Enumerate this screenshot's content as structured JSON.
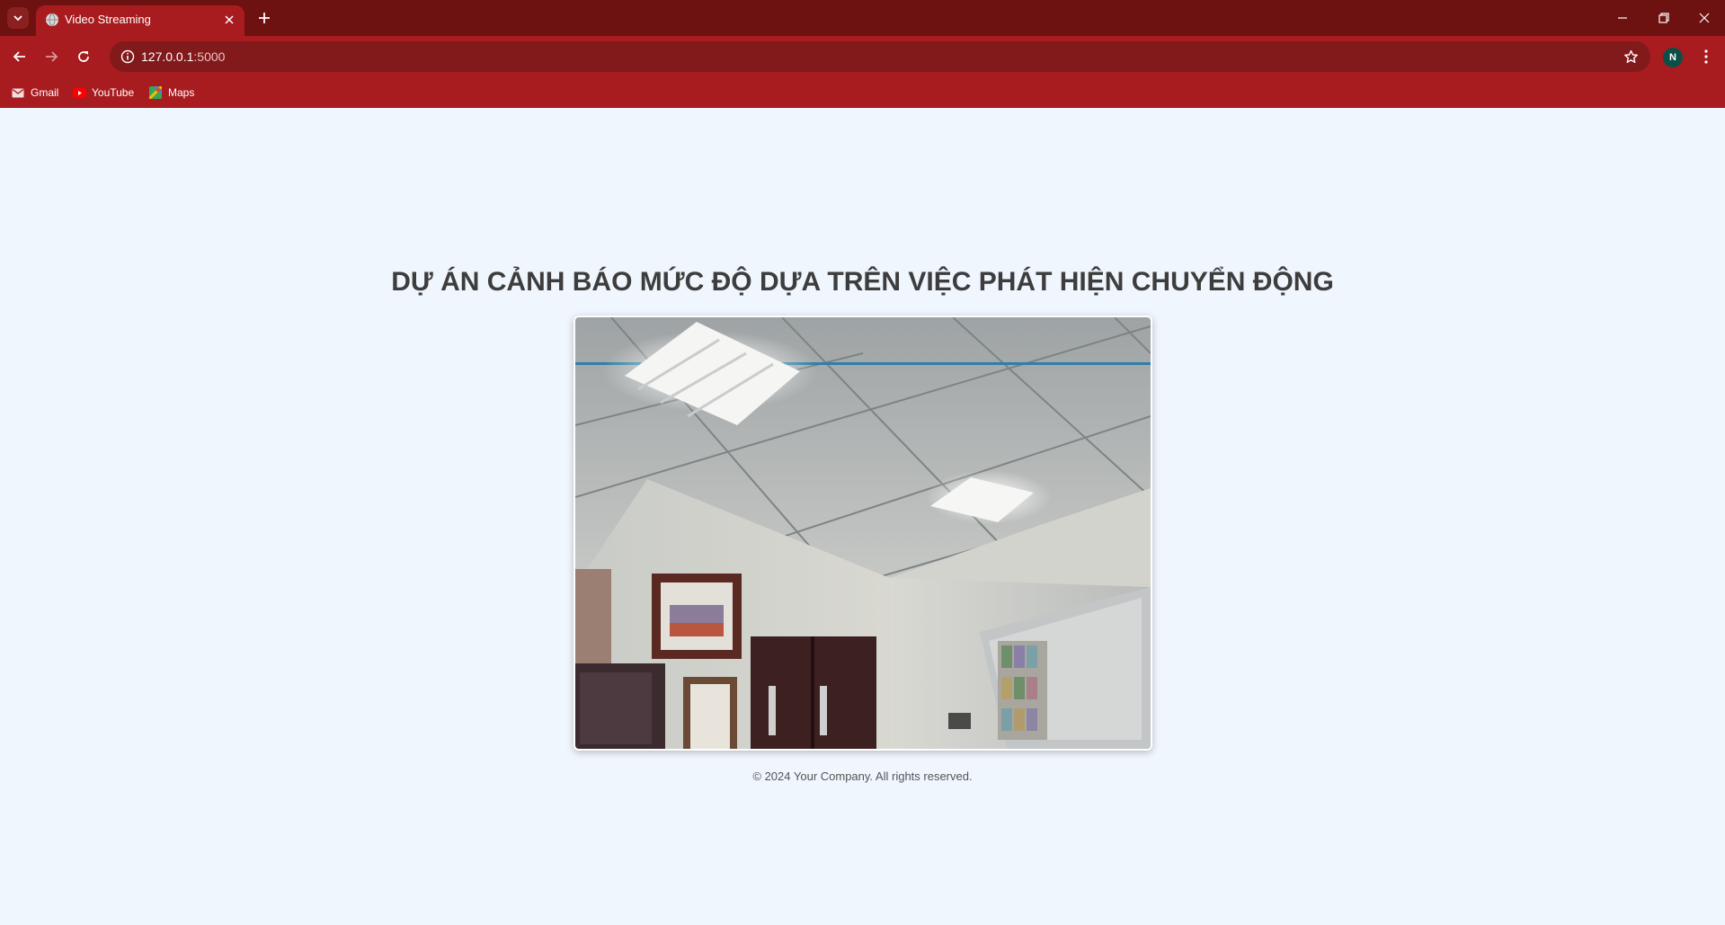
{
  "browser": {
    "tab": {
      "title": "Video Streaming",
      "favicon": "globe-icon"
    },
    "address_bar": {
      "host": "127.0.0.1",
      "port": ":5000",
      "icon": "info-icon"
    },
    "profile_initial": "N",
    "bookmarks": [
      {
        "label": "Gmail",
        "icon": "gmail-icon"
      },
      {
        "label": "YouTube",
        "icon": "youtube-icon"
      },
      {
        "label": "Maps",
        "icon": "maps-icon"
      }
    ],
    "colors": {
      "frame": "#6e1111",
      "toolbar": "#a81b1f",
      "omnibox": "#821a1c"
    }
  },
  "page": {
    "heading": "DỰ ÁN CẢNH BÁO MỨC ĐỘ DỰA TRÊN VIỆC PHÁT HIỆN CHUYỂN ĐỘNG",
    "video": {
      "description_icon": "video-stream"
    },
    "footer": "© 2024 Your Company. All rights reserved.",
    "colors": {
      "background": "#f0f6fd",
      "heading": "#3d3d3d"
    }
  }
}
